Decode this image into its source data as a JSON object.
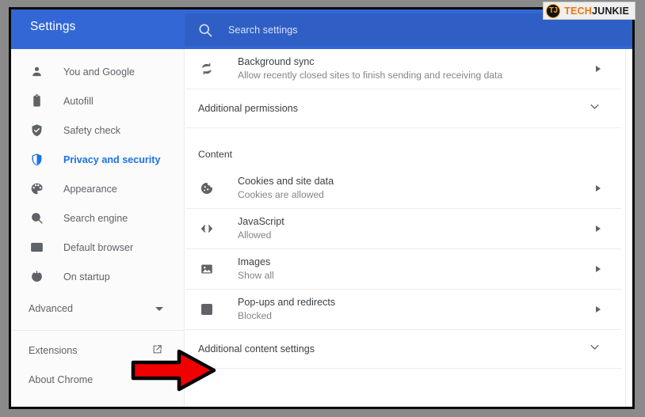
{
  "window": {
    "header_title": "Settings",
    "search": {
      "placeholder": "Search settings",
      "icon": "search-icon"
    }
  },
  "logo": {
    "badge_text": "TJ",
    "word_primary": "TECH",
    "word_secondary": "JUNKIE",
    "accent_color": "#e8780c"
  },
  "sidebar": {
    "items": [
      {
        "label": "You and Google",
        "icon": "person-icon",
        "active": false
      },
      {
        "label": "Autofill",
        "icon": "clipboard-icon",
        "active": false
      },
      {
        "label": "Safety check",
        "icon": "shield-check-icon",
        "active": false
      },
      {
        "label": "Privacy and security",
        "icon": "shield-icon",
        "active": true
      },
      {
        "label": "Appearance",
        "icon": "palette-icon",
        "active": false
      },
      {
        "label": "Search engine",
        "icon": "magnifier-icon",
        "active": false
      },
      {
        "label": "Default browser",
        "icon": "browser-window-icon",
        "active": false
      },
      {
        "label": "On startup",
        "icon": "power-icon",
        "active": false
      }
    ],
    "advanced": {
      "label": "Advanced",
      "icon": "caret-down-icon"
    },
    "footer_items": [
      {
        "label": "Extensions",
        "icon": "external-link-icon"
      },
      {
        "label": "About Chrome",
        "icon": ""
      }
    ]
  },
  "main": {
    "rows": [
      {
        "title": "Background sync",
        "subtitle": "Allow recently closed sites to finish sending and receiving data",
        "icon": "sync-icon",
        "control": "chevron-right-icon"
      },
      {
        "title": "Additional permissions",
        "subtitle": "",
        "icon": "",
        "control": "chevron-down-icon"
      }
    ],
    "section_label": "Content",
    "content_rows": [
      {
        "title": "Cookies and site data",
        "subtitle": "Cookies are allowed",
        "icon": "cookie-icon",
        "control": "chevron-right-icon"
      },
      {
        "title": "JavaScript",
        "subtitle": "Allowed",
        "icon": "code-brackets-icon",
        "control": "chevron-right-icon"
      },
      {
        "title": "Images",
        "subtitle": "Show all",
        "icon": "image-icon",
        "control": "chevron-right-icon"
      },
      {
        "title": "Pop-ups and redirects",
        "subtitle": "Blocked",
        "icon": "external-link-icon",
        "control": "chevron-right-icon"
      }
    ],
    "additional_content_settings": {
      "title": "Additional content settings",
      "control": "chevron-down-icon"
    }
  },
  "annotation": {
    "arrow_color": "#f00000",
    "arrow_outline": "#000000",
    "points_to": "Additional content settings"
  },
  "colors": {
    "header_blue": "#3367d6",
    "search_blue": "#2f5fc4",
    "active_blue": "#1a73e8",
    "text_primary": "#3c4043",
    "text_secondary": "#80868b",
    "sidebar_bg": "#fbfbfb"
  }
}
